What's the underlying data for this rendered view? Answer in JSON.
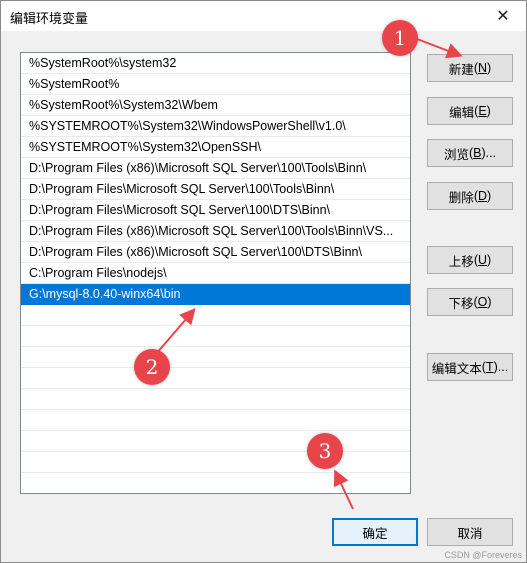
{
  "window": {
    "title": "编辑环境变量",
    "close_glyph": "✕"
  },
  "paths": [
    "%SystemRoot%\\system32",
    "%SystemRoot%",
    "%SystemRoot%\\System32\\Wbem",
    "%SYSTEMROOT%\\System32\\WindowsPowerShell\\v1.0\\",
    "%SYSTEMROOT%\\System32\\OpenSSH\\",
    "D:\\Program Files (x86)\\Microsoft SQL Server\\100\\Tools\\Binn\\",
    "D:\\Program Files\\Microsoft SQL Server\\100\\Tools\\Binn\\",
    "D:\\Program Files\\Microsoft SQL Server\\100\\DTS\\Binn\\",
    "D:\\Program Files (x86)\\Microsoft SQL Server\\100\\Tools\\Binn\\VS...",
    "D:\\Program Files (x86)\\Microsoft SQL Server\\100\\DTS\\Binn\\",
    "C:\\Program Files\\nodejs\\",
    "G:\\mysql-8.0.40-winx64\\bin"
  ],
  "selected_index": 11,
  "buttons": {
    "new": {
      "label": "新建",
      "key": "N"
    },
    "edit": {
      "label": "编辑",
      "key": "E"
    },
    "browse": {
      "label": "浏览",
      "key": "B",
      "suffix": "..."
    },
    "delete": {
      "label": "删除",
      "key": "D"
    },
    "move_up": {
      "label": "上移",
      "key": "U"
    },
    "move_down": {
      "label": "下移",
      "key": "O"
    },
    "edit_text": {
      "label": "编辑文本",
      "key": "T",
      "suffix": "..."
    },
    "ok": "确定",
    "cancel": "取消"
  },
  "annotations": [
    "1",
    "2",
    "3"
  ],
  "annotation_color": "#e8454a",
  "watermark": "CSDN @Foreveres"
}
